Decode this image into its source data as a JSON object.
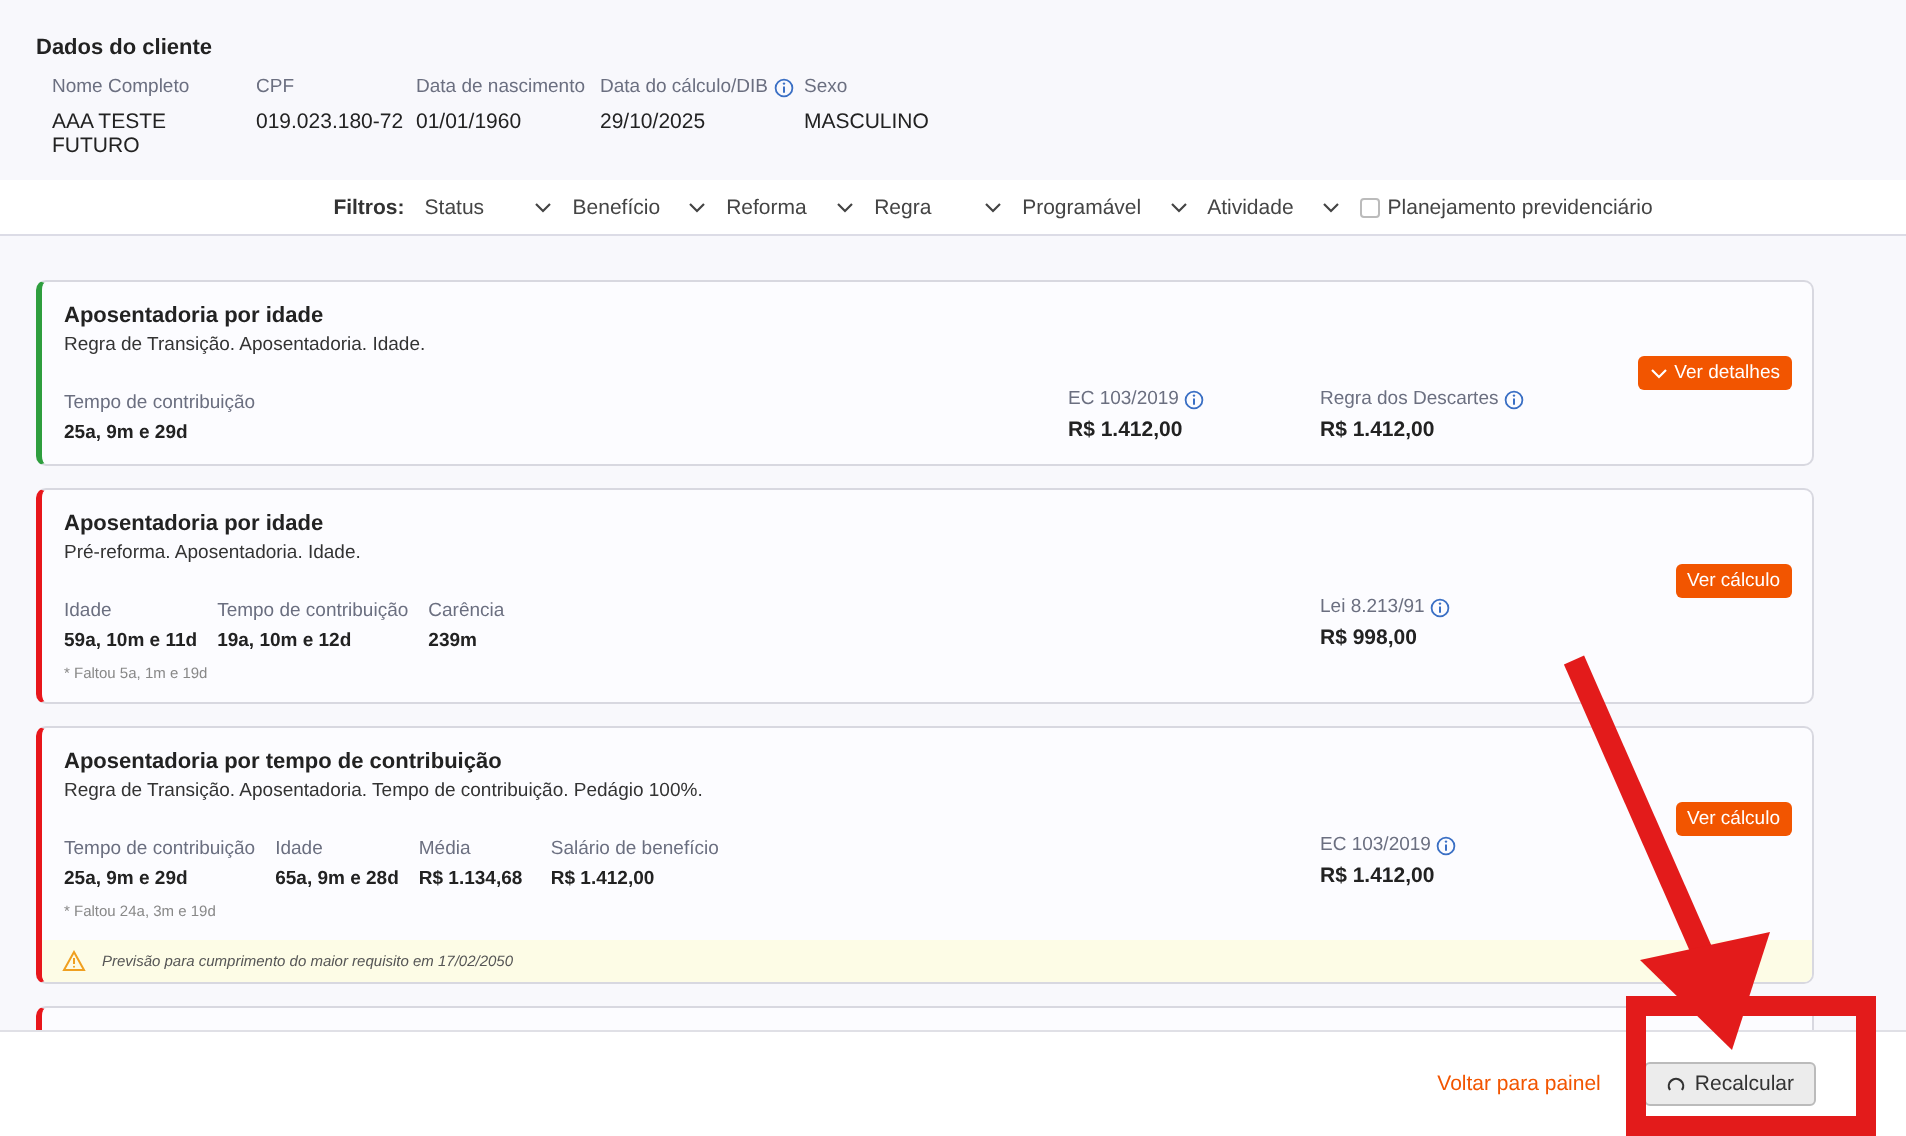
{
  "client": {
    "title": "Dados do cliente",
    "fields": [
      {
        "label": "Nome Completo",
        "value": "AAA TESTE FUTURO",
        "info": false
      },
      {
        "label": "CPF",
        "value": "019.023.180-72",
        "info": false
      },
      {
        "label": "Data de nascimento",
        "value": "01/01/1960",
        "info": false
      },
      {
        "label": "Data do cálculo/DIB",
        "value": "29/10/2025",
        "info": true
      },
      {
        "label": "Sexo",
        "value": "MASCULINO",
        "info": false
      }
    ]
  },
  "filters": {
    "label": "Filtros:",
    "dropdowns": [
      "Status",
      "Benefício",
      "Reforma",
      "Regra",
      "Programável",
      "Atividade"
    ],
    "checkbox": {
      "label": "Planejamento previdenciário",
      "checked": false
    }
  },
  "cards": [
    {
      "title": "Aposentadoria por idade",
      "subtitle": "Regra de Transição. Aposentadoria. Idade.",
      "color": "#2e9e3e",
      "metrics": [
        {
          "label": "Tempo de contribuição",
          "value": "25a, 9m e 29d"
        }
      ],
      "results": [
        {
          "label": "EC 103/2019",
          "value": "R$ 1.412,00",
          "info": true
        },
        {
          "label": "Regra dos Descartes",
          "value": "R$ 1.412,00",
          "info": true
        }
      ],
      "action": {
        "kind": "details",
        "label": "Ver detalhes"
      }
    },
    {
      "title": "Aposentadoria por idade",
      "subtitle": "Pré-reforma. Aposentadoria. Idade.",
      "color": "#e8161b",
      "metrics": [
        {
          "label": "Idade",
          "value": "59a, 10m e 11d"
        },
        {
          "label": "Tempo de contribuição",
          "value": "19a, 10m e 12d"
        },
        {
          "label": "Carência",
          "value": "239m"
        }
      ],
      "note": "* Faltou 5a, 1m e 19d",
      "results": [
        {
          "label": "Lei 8.213/91",
          "value": "R$ 998,00",
          "info": true
        }
      ],
      "action": {
        "kind": "calc",
        "label": "Ver cálculo"
      }
    },
    {
      "title": "Aposentadoria por tempo de contribuição",
      "subtitle": "Regra de Transição. Aposentadoria. Tempo de contribuição. Pedágio 100%.",
      "color": "#e8161b",
      "metrics": [
        {
          "label": "Tempo de contribuição",
          "value": "25a, 9m e 29d"
        },
        {
          "label": "Idade",
          "value": "65a, 9m e 28d"
        },
        {
          "label": "Média",
          "value": "R$ 1.134,68"
        },
        {
          "label": "Salário de benefício",
          "value": "R$ 1.412,00"
        }
      ],
      "note": "* Faltou 24a, 3m e 19d",
      "results": [
        {
          "label": "EC 103/2019",
          "value": "R$ 1.412,00",
          "info": true
        }
      ],
      "action": {
        "kind": "calc",
        "label": "Ver cálculo"
      },
      "warning": "Previsão para cumprimento do maior requisito em 17/02/2050"
    },
    {
      "color": "#e8161b"
    }
  ],
  "footer": {
    "link": "Voltar para painel",
    "button": "Recalcular"
  }
}
